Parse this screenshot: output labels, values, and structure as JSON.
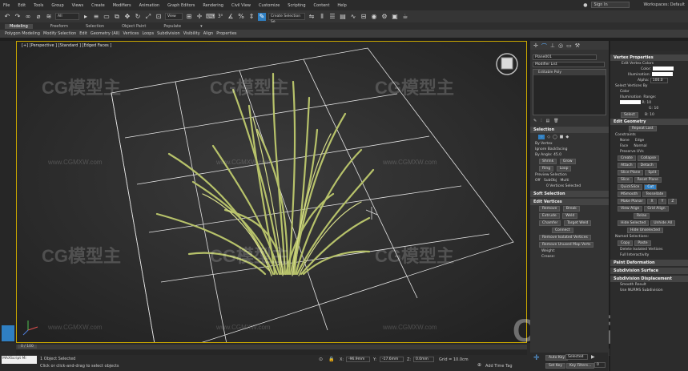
{
  "menubar": {
    "items": [
      "File",
      "Edit",
      "Tools",
      "Group",
      "Views",
      "Create",
      "Modifiers",
      "Animation",
      "Graph Editors",
      "Rendering",
      "Civil View",
      "Customize",
      "Scripting",
      "Content",
      "Help"
    ],
    "sign_in": "Sign In",
    "workspaces": "Workspaces: Default"
  },
  "toolbar": {
    "filter_dropdown": "All",
    "view_dropdown": "View",
    "selection_set": "Create Selection Se"
  },
  "ribbon": {
    "tabs": [
      "Modeling",
      "Freeform",
      "Selection",
      "Object Paint",
      "Populate"
    ],
    "sub_items": [
      "Polygon Modeling",
      "Modify Selection",
      "Edit",
      "Geometry (All)",
      "Vertices",
      "Loops",
      "Subdivision",
      "Visibility",
      "Align",
      "Properties"
    ]
  },
  "viewport": {
    "label": "[+] [Perspective ] [Standard ] [Edged Faces ]"
  },
  "command_panel": {
    "object_name": "Plane001",
    "modifier_list": "Modifier List",
    "stack_item": "Editable Poly",
    "selection_header": "Selection",
    "by_vertex": "By Vertex",
    "ignore_backfacing": "Ignore Backfacing",
    "by_angle": "By Angle:",
    "angle_value": "45.0",
    "shrink": "Shrink",
    "grow": "Grow",
    "ring": "Ring",
    "loop": "Loop",
    "preview_selection": "Preview Selection",
    "off": "Off",
    "subobj": "SubObj",
    "multi": "Multi",
    "vertices_selected": "0 Vertices Selected",
    "soft_selection": "Soft Selection",
    "edit_vertices": "Edit Vertices",
    "remove": "Remove",
    "break": "Break",
    "extrude": "Extrude",
    "weld": "Weld",
    "chamfer": "Chamfer",
    "target_weld": "Target Weld",
    "connect": "Connect",
    "remove_isolated": "Remove Isolated Vertices",
    "remove_unused": "Remove Unused Map Verts",
    "weight_label": "Weight:",
    "crease_label": "Crease:"
  },
  "right_panel": {
    "workspace": "Workspaces: Default",
    "vertex_properties": "Vertex Properties",
    "edit_vertex_colors": "Edit Vertex Colors",
    "color": "Color:",
    "illumination": "Illumination:",
    "alpha": "Alpha:",
    "alpha_value": "100.0",
    "select_by": "Select Vertices By",
    "color_opt": "Color",
    "illum_opt": "Illumination",
    "range": "Range:",
    "r": "R:",
    "g": "G:",
    "b": "B:",
    "range_val": "10",
    "select_btn": "Select",
    "edit_geometry": "Edit Geometry",
    "repeat_last": "Repeat Last",
    "constraints": "Constraints",
    "none": "None",
    "edge": "Edge",
    "face": "Face",
    "normal": "Normal",
    "preserve_uvs": "Preserve UVs",
    "create": "Create",
    "collapse": "Collapse",
    "attach": "Attach",
    "detach": "Detach",
    "slice_plane": "Slice Plane",
    "split": "Split",
    "slice": "Slice",
    "reset_plane": "Reset Plane",
    "quickslice": "QuickSlice",
    "cut": "Cut",
    "msmooth": "MSmooth",
    "tessellate": "Tessellate",
    "make_planar": "Make Planar",
    "x": "X",
    "y": "Y",
    "z": "Z",
    "view_align": "View Align",
    "grid_align": "Grid Align",
    "relax": "Relax",
    "hide_selected": "Hide Selected",
    "unhide_all": "Unhide All",
    "hide_unselected": "Hide Unselected",
    "named_selections": "Named Selections:",
    "copy": "Copy",
    "paste": "Paste",
    "delete_isolated": "Delete Isolated Vertices",
    "full_interactivity": "Full Interactivity",
    "paint_deformation": "Paint Deformation",
    "subdivision_surface": "Subdivision Surface",
    "subdivision_displacement": "Subdivision Displacement",
    "smooth_result": "Smooth Result",
    "use_nurms": "Use NURMS Subdivision"
  },
  "status": {
    "object_selected": "1 Object Selected",
    "hint": "Click or click-and-drag to select objects",
    "timeline_pos": "0 / 100",
    "script": "MAXScript Mi",
    "x_label": "X:",
    "y_label": "Y:",
    "z_label": "Z:",
    "x_value": "-96.9mm",
    "y_value": "-17.6mm",
    "z_value": "0.0mm",
    "grid": "Grid = 10.0cm",
    "auto_key": "Auto Key",
    "selected": "Selected",
    "set_key": "Set Key",
    "key_filters": "Key Filters...",
    "add_time_tag": "Add Time Tag",
    "frame": "0"
  },
  "watermark": {
    "brand": "CG模型主",
    "url": "www.CGMXW.com"
  },
  "colors": {
    "accent": "#2f7fc2",
    "viewport_border": "#c8a600",
    "grass": "#b7c26a"
  }
}
